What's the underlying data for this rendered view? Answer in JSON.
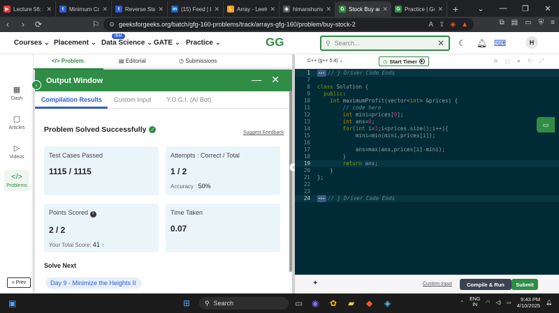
{
  "browser": {
    "tabs": [
      {
        "title": "Lecture 56: Large",
        "fav": "▶",
        "color": "#e53935"
      },
      {
        "title": "Minimum Cost T",
        "fav": "t",
        "color": "#2f5bd3"
      },
      {
        "title": "Reverse Stack Us",
        "fav": "t",
        "color": "#2f5bd3"
      },
      {
        "title": "(15) Feed | Linke",
        "fav": "in",
        "color": "#0a66c2"
      },
      {
        "title": "Array - LeetCode",
        "fav": "L",
        "color": "#ffa116"
      },
      {
        "title": "himanshumaurya",
        "fav": "◉",
        "color": "#555"
      },
      {
        "title": "Stock Buy an",
        "fav": "G",
        "color": "#2f8d46"
      },
      {
        "title": "Practice | Geeksf",
        "fav": "G",
        "color": "#2f8d46"
      }
    ],
    "new_tab": "+",
    "url": "geeksforgeeks.org/batch/gfg-160-problems/track/arrays-gfg-160/problem/buy-stock-2"
  },
  "site": {
    "nav": {
      "courses": "Courses",
      "placement": "Placement",
      "data_science": "Data Science",
      "data_science_badge": "IBM",
      "gate": "GATE",
      "practice": "Practice"
    },
    "logo": "GG",
    "search_placeholder": "Search...",
    "avatar": "H"
  },
  "sidebar": {
    "items": [
      {
        "label": "Dash"
      },
      {
        "label": "Articles"
      },
      {
        "label": "Videos"
      },
      {
        "label": "Problems"
      }
    ],
    "prev": "« Prev"
  },
  "problem_tabs": {
    "problem": "Problem",
    "editorial": "Editorial",
    "submissions": "Submissions"
  },
  "output": {
    "title": "Output Window",
    "tabs": {
      "compilation": "Compilation Results",
      "custom": "Custom Input",
      "yogi": "Y.O.G.I. (AI Bot)"
    },
    "status": "Problem Solved Successfully",
    "suggest": "Suggest Feedback",
    "cards": {
      "tests_label": "Test Cases Passed",
      "tests_value": "1115 / 1115",
      "attempts_label": "Attempts : Correct / Total",
      "attempts_value": "1 / 2",
      "accuracy_label": "Accuracy :",
      "accuracy_value": "50%",
      "points_label": "Points Scored",
      "points_value": "2 / 2",
      "total_label": "Your Total Score:",
      "total_value": "41",
      "time_label": "Time Taken",
      "time_value": "0.07"
    },
    "solve_next": "Solve Next",
    "next_problem": "Day 9 - Minimize the Heights II"
  },
  "editor": {
    "language": "C++ (g++ 5.4)",
    "timer": "Start Timer",
    "custom_input": "Custom Input",
    "compile": "Compile & Run",
    "submit": "Submit",
    "lines": [
      {
        "n": "1",
        "html": "<span class='cm'><span class='fold'>▸▸▸</span>// } Driver Code Ends</span>",
        "hl": true
      },
      {
        "n": "7",
        "html": ""
      },
      {
        "n": "8",
        "html": "<span class='kw'>class</span> <span class='tx'>Solution {</span>"
      },
      {
        "n": "9",
        "html": "  <span class='kw'>public</span><span class='tx'>:</span>"
      },
      {
        "n": "10",
        "html": "    <span class='ty'>int</span> <span class='tx'>maximumProfit(vector&lt;</span><span class='ty'>int</span><span class='tx'>&gt; &amp;prices) {</span>"
      },
      {
        "n": "11",
        "html": "        <span class='cm'>// code here</span>"
      },
      {
        "n": "12",
        "html": "        <span class='ty'>int</span> <span class='tx'>mini=prices[</span><span class='nm'>0</span><span class='tx'>];</span>"
      },
      {
        "n": "13",
        "html": "        <span class='ty'>int</span> <span class='tx'>ans=</span><span class='nm'>0</span><span class='tx'>;</span>"
      },
      {
        "n": "14",
        "html": "        <span class='kw'>for</span><span class='tx'>(</span><span class='ty'>int</span> <span class='tx'>i=</span><span class='nm'>1</span><span class='tx'>;i&lt;prices.size();i++){</span>"
      },
      {
        "n": "15",
        "html": "            <span class='tx'>mini=min(mini,prices[i]);</span>"
      },
      {
        "n": "16",
        "html": ""
      },
      {
        "n": "17",
        "html": "            <span class='tx'>ans=max(ans,prices[i]-mini);</span>"
      },
      {
        "n": "18",
        "html": "        <span class='tx'>}</span>"
      },
      {
        "n": "19",
        "html": "        <span class='kw'>return</span> <span class='tx'>ans;</span>",
        "hl": true
      },
      {
        "n": "20",
        "html": "    <span class='tx'>}</span>"
      },
      {
        "n": "21",
        "html": "<span class='tx'>};</span>"
      },
      {
        "n": "22",
        "html": ""
      },
      {
        "n": "23",
        "html": ""
      },
      {
        "n": "24",
        "html": "<span class='cm'><span class='fold'>▸▸▸</span>// } Driver Code Ends</span>",
        "hl": true
      }
    ]
  },
  "taskbar": {
    "search": "Search",
    "lang": "ENG",
    "region": "IN",
    "time": "9:43 PM",
    "date": "4/10/2025"
  }
}
